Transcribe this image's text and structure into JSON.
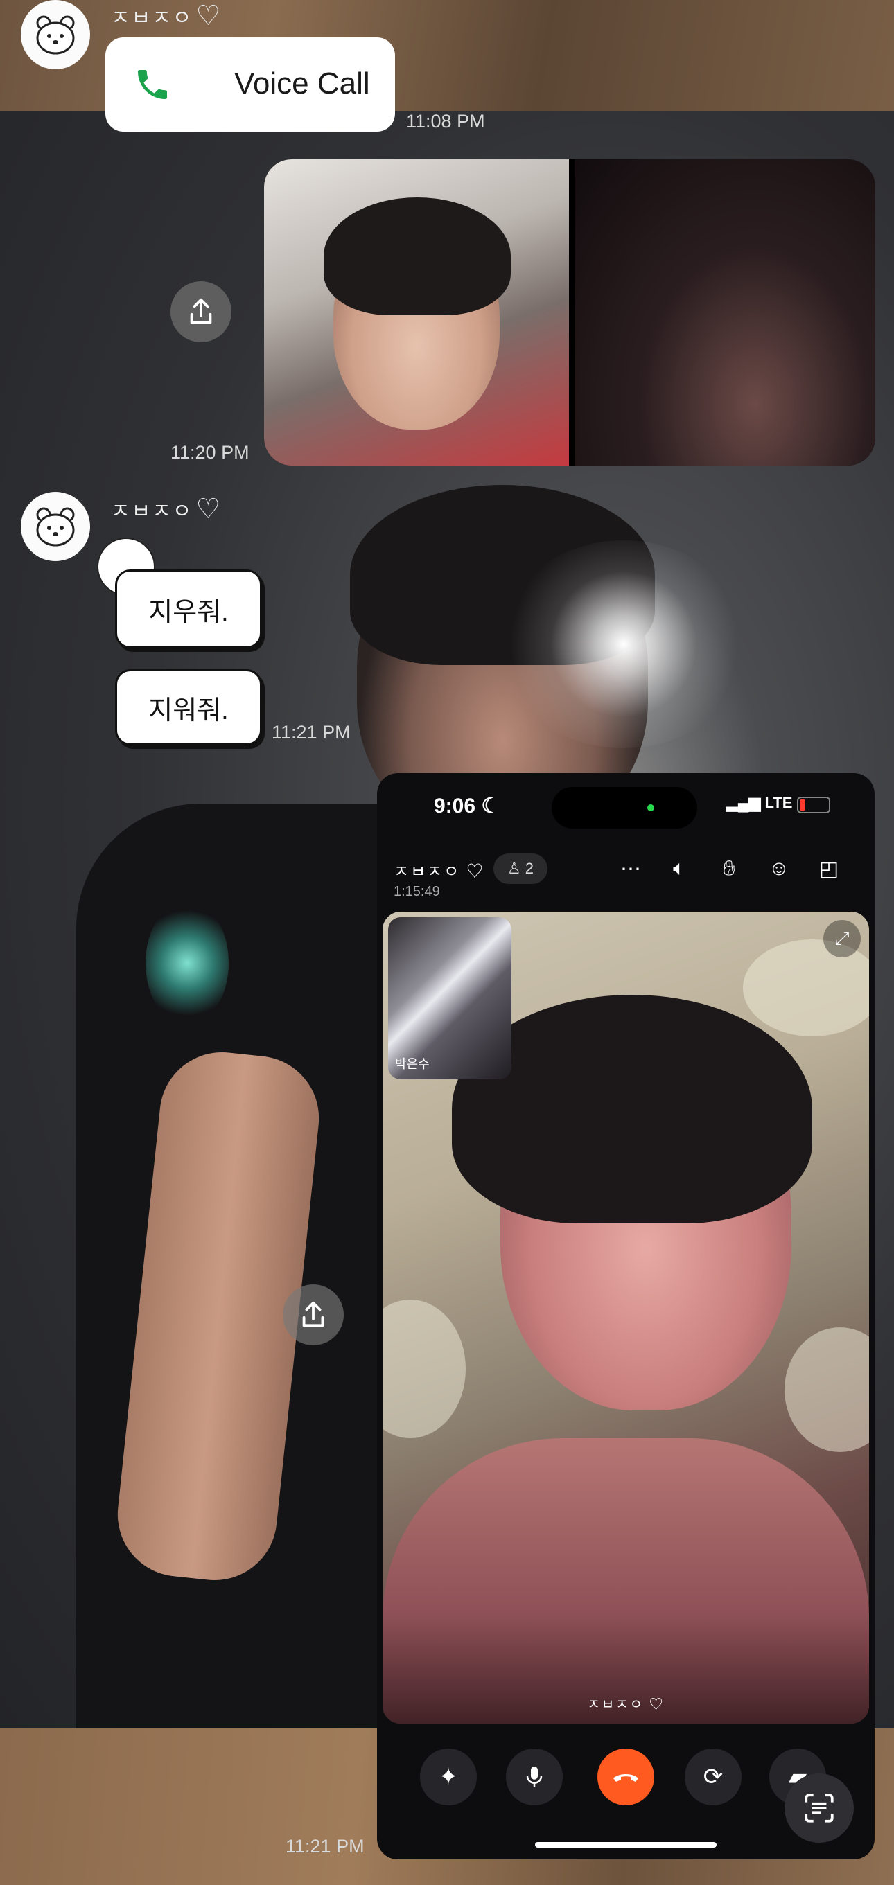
{
  "messages": {
    "sender_name": "ㅈㅂㅈㅇ",
    "voice_call": {
      "label": "Voice Call",
      "time": "11:08 PM"
    },
    "photos": {
      "time": "11:20 PM"
    },
    "stickers": [
      {
        "text": "지우줘."
      },
      {
        "text": "지워줘."
      }
    ],
    "stickers_time": "11:21 PM",
    "last_time": "11:21 PM"
  },
  "call_screenshot": {
    "status_time": "9:06",
    "network": "LTE",
    "title": "ㅈㅂㅈㅇ",
    "participants": "2",
    "duration": "1:15:49",
    "pip_label": "박은수",
    "video_name": "ㅈㅂㅈㅇ",
    "header_icons": [
      "more-icon",
      "speaker-icon",
      "hand-icon",
      "emoji-icon",
      "layout-icon"
    ],
    "controls": [
      "effects-icon",
      "mic-icon",
      "end-call-icon",
      "flip-camera-icon",
      "video-icon"
    ]
  },
  "colors": {
    "end_call": "#ff5a1f",
    "voice_icon": "#1aa34a",
    "bubble": "#ffffff"
  }
}
